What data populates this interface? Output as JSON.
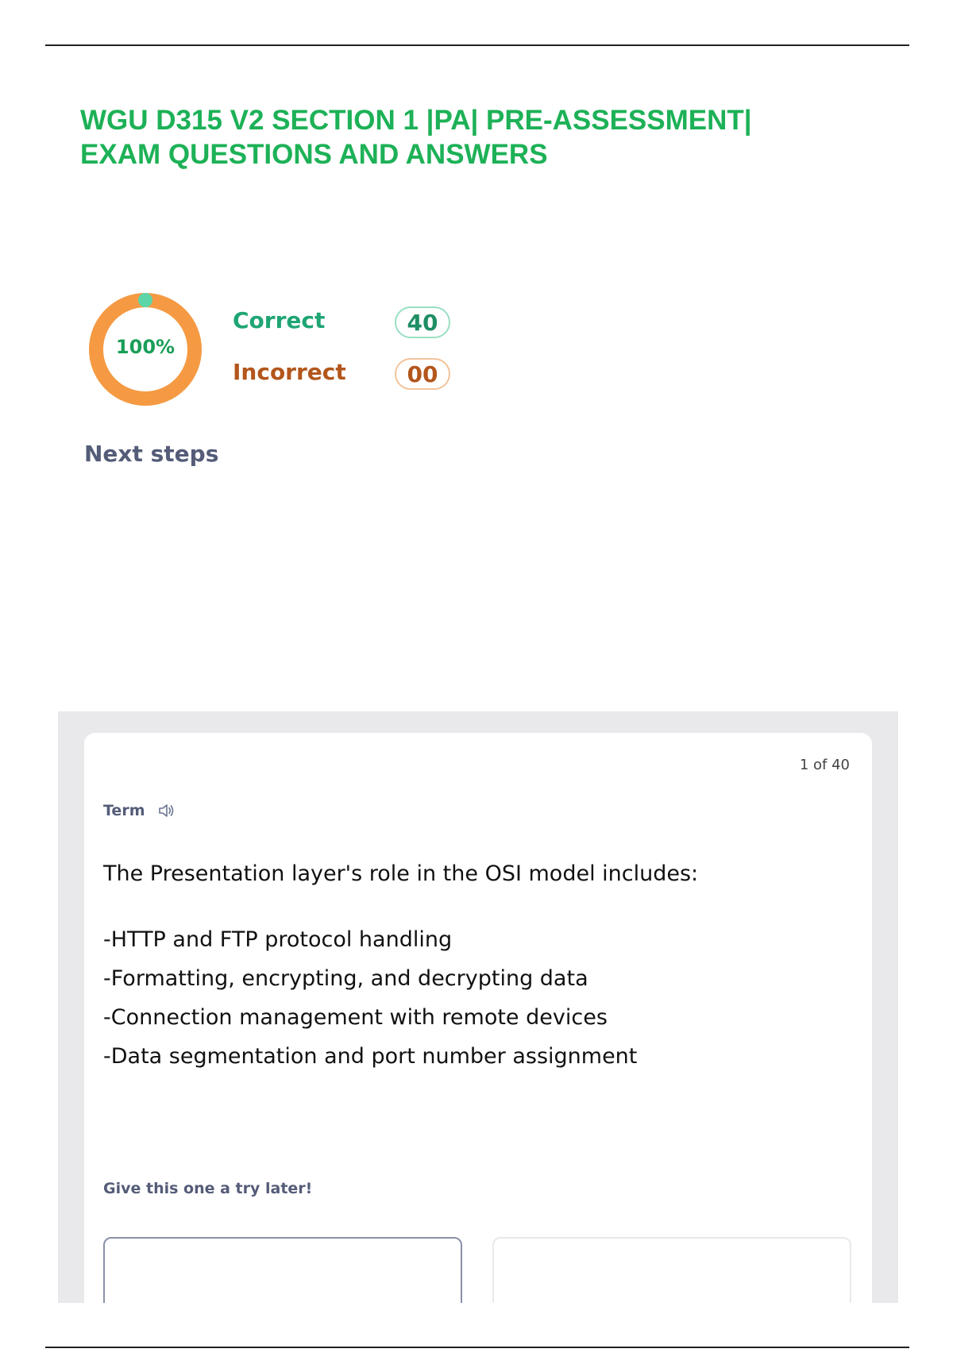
{
  "document": {
    "title_line1": "WGU D315 V2 SECTION 1 |PA| PRE-ASSESSMENT|",
    "title_line2": "EXAM QUESTIONS AND ANSWERS"
  },
  "score": {
    "percent_label": "100%",
    "percent_value": 100,
    "correct_label": "Correct",
    "correct_count": "40",
    "incorrect_label": "Incorrect",
    "incorrect_count": "00",
    "colors": {
      "correct": "#1fa574",
      "incorrect": "#b3561c",
      "ring": "#f59a43",
      "ring_marker": "#5cd6a9"
    }
  },
  "next_steps_label": "Next steps",
  "flashcard": {
    "counter": "1 of 40",
    "term_label": "Term",
    "audio_icon": "speaker-icon",
    "question": "The Presentation layer's role in the OSI model includes:",
    "options": [
      "-HTTP and FTP protocol handling",
      "-Formatting,  encrypting,  and  decrypting  data",
      "-Connection management with remote devices",
      "-Data  segmentation  and  port  number assignment"
    ],
    "try_later_label": "Give this one a try later!"
  }
}
